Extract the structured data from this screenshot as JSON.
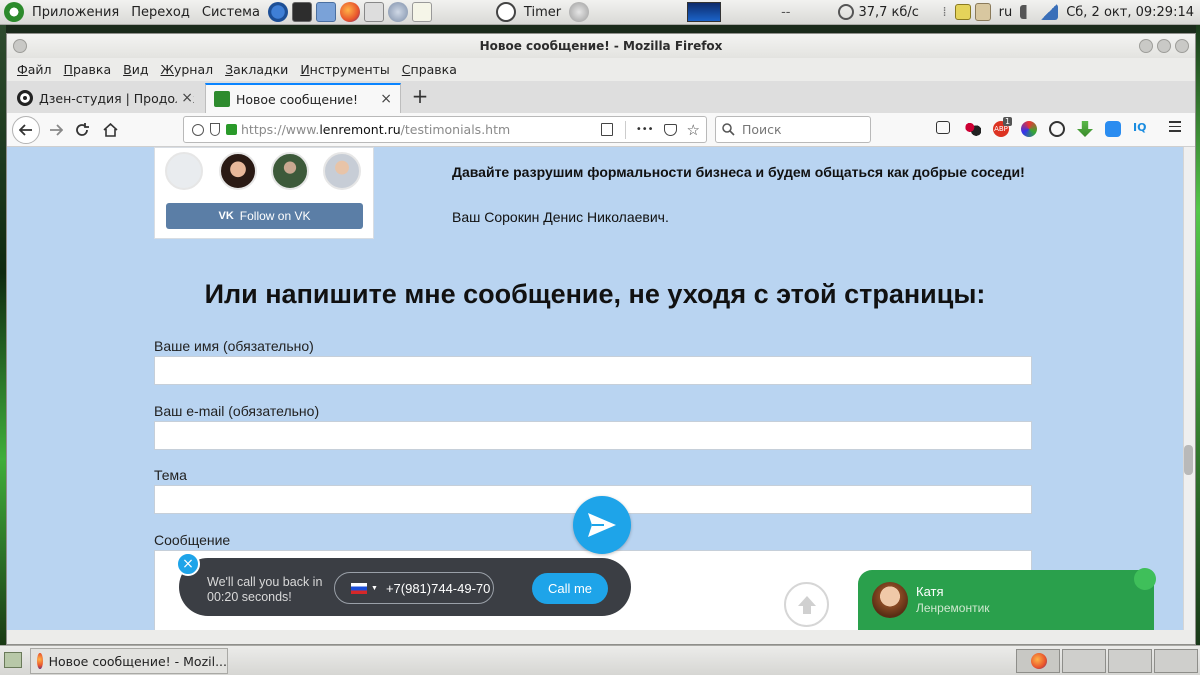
{
  "panel": {
    "menu": [
      "Приложения",
      "Переход",
      "Система"
    ],
    "timer_label": "Timer",
    "separator": "--",
    "net_speed": "37,7 кб/с",
    "layout": "ru",
    "clock": "Сб,  2 окт, 09:29:14"
  },
  "window": {
    "title": "Новое сообщение! - Mozilla Firefox",
    "menu": [
      "Файл",
      "Правка",
      "Вид",
      "Журнал",
      "Закладки",
      "Инструменты",
      "Справка"
    ]
  },
  "tabs": [
    {
      "label": "Дзен-студия | Продолж",
      "active": false
    },
    {
      "label": "Новое сообщение!",
      "active": true
    }
  ],
  "tab_close": "×",
  "new_tab": "+",
  "navbar": {
    "url_prefix": "https://www.",
    "url_domain": "lenremont.ru",
    "url_path": "/testimonials.htm",
    "more": "•••",
    "search_placeholder": "Поиск",
    "abp_badge": "1",
    "iq_label": "IQ"
  },
  "page": {
    "vk_follow": "Follow on VK",
    "line1": "Давайте разрушим формальности бизнеса и будем общаться как добрые соседи!",
    "line2": "Ваш Сорокин Денис Николаевич.",
    "heading": "Или напишите мне сообщение, не уходя с этой страницы:",
    "fields": [
      {
        "label": "Ваше имя (обязательно)"
      },
      {
        "label": "Ваш e-mail (обязательно)"
      },
      {
        "label": "Тема"
      },
      {
        "label": "Сообщение"
      }
    ]
  },
  "callback": {
    "close": "×",
    "text": "We'll call you back in 00:20 seconds!",
    "phone": "+7(981)744-49-70",
    "button": "Call me"
  },
  "chat": {
    "name": "Катя",
    "subtitle": "Ленремонтик"
  },
  "taskbar": {
    "firefox_item": "Новое сообщение! - Mozil..."
  }
}
